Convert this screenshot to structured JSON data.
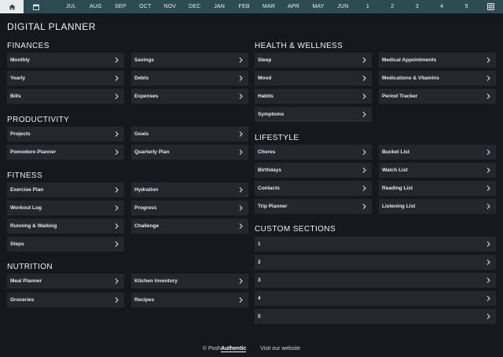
{
  "nav": {
    "tabs": [
      "JUL",
      "AUG",
      "SEP",
      "OCT",
      "NOV",
      "DEC",
      "JAN",
      "FEB",
      "MAR",
      "APR",
      "MAY",
      "JUN",
      "1",
      "2",
      "3",
      "4",
      "5"
    ]
  },
  "title": "DIGITAL PLANNER",
  "sections": {
    "finances": {
      "title": "FINANCES",
      "items": [
        "Monthly",
        "Savings",
        "Yearly",
        "Debts",
        "Bills",
        "Expenses"
      ]
    },
    "productivity": {
      "title": "PRODUCTIVITY",
      "items": [
        "Projects",
        "Goals",
        "Pomodoro Planner",
        "Quarterly Plan"
      ]
    },
    "fitness": {
      "title": "FITNESS",
      "items": [
        "Exercise Plan",
        "Hydration",
        "Workout Log",
        "Progress",
        "Running & Walking",
        "Challenge",
        "Steps"
      ]
    },
    "nutrition": {
      "title": "NUTRITION",
      "items": [
        "Meal Planner",
        "Kitchen Inventory",
        "Groceries",
        "Recipes"
      ]
    },
    "health": {
      "title": "HEALTH & WELLNESS",
      "items": [
        "Sleep",
        "Medical Appointments",
        "Mood",
        "Medications & Vitamins",
        "Habits",
        "Period Tracker",
        "Symptoms"
      ]
    },
    "lifestyle": {
      "title": "LIFESTYLE",
      "items": [
        "Chores",
        "Bucket List",
        "Birthdays",
        "Watch List",
        "Contacts",
        "Reading List",
        "Trip Planner",
        "Listening List"
      ]
    },
    "custom": {
      "title": "CUSTOM SECTIONS",
      "items": [
        "1",
        "2",
        "3",
        "4",
        "5"
      ]
    }
  },
  "footer": {
    "copyright_prefix": "© Posh",
    "copyright_brand": "Authentic",
    "website_link": "Visit our website"
  },
  "colors": {
    "background": "#15191e",
    "nav_bar": "#2d4b52",
    "item_bg": "#24282e",
    "text": "#e6e8ea"
  }
}
